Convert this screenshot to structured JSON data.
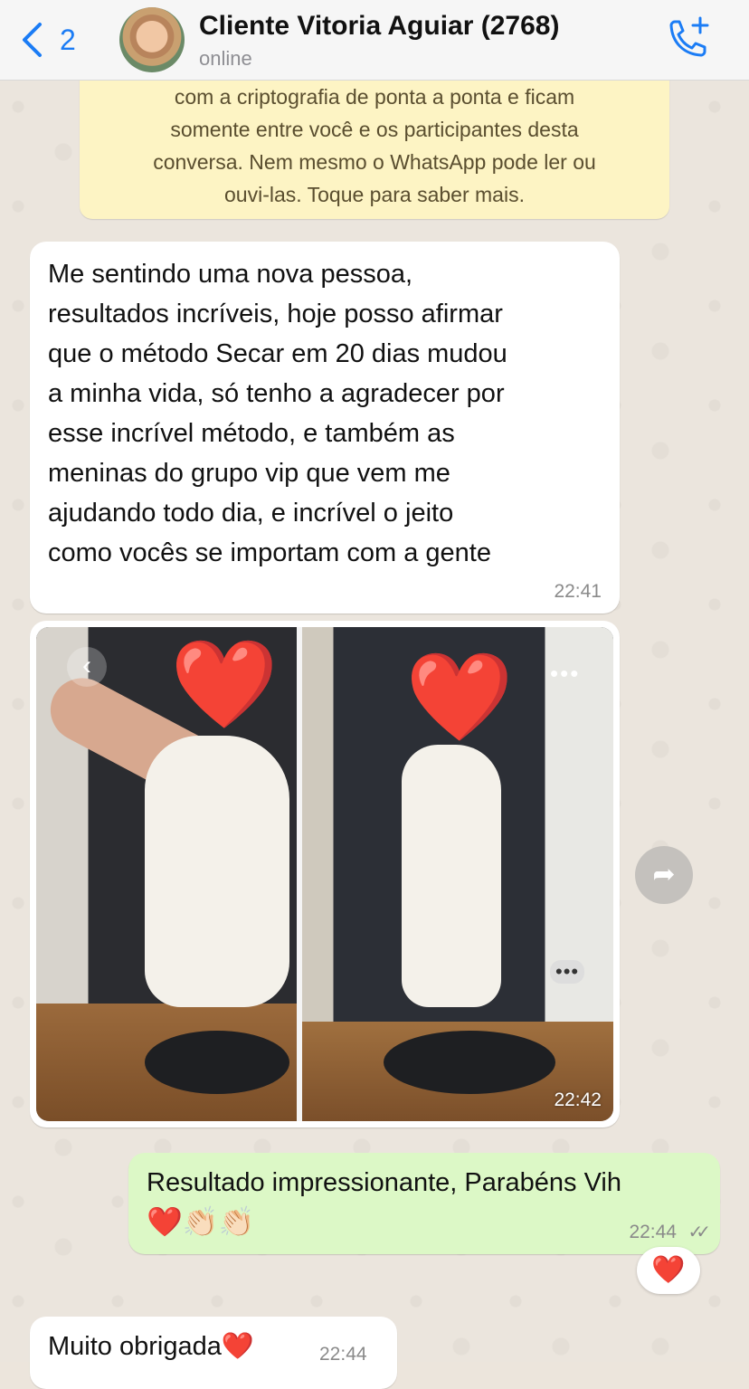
{
  "header": {
    "back_count": "2",
    "contact_name": "Cliente Vitoria Aguiar  (2768)",
    "contact_status": "online"
  },
  "notice": {
    "lines": [
      "com a criptografia de ponta a ponta e ficam",
      "somente entre você e os participantes desta",
      "conversa. Nem mesmo o WhatsApp pode ler ou",
      "ouvi-las. Toque para saber mais."
    ]
  },
  "messages": [
    {
      "direction": "incoming",
      "lines": [
        "Me sentindo uma nova pessoa,",
        "resultados incríveis, hoje posso afirmar",
        "que o método Secar em 20 dias mudou",
        "a minha vida, só tenho a agradecer por",
        "esse incrível método, e também as",
        "meninas do grupo vip que vem me",
        "ajudando todo dia, e incrível o jeito",
        "como vocês se importam com a gente"
      ],
      "time": "22:41"
    },
    {
      "direction": "incoming",
      "type": "image",
      "time": "22:42",
      "overlay_hearts": [
        "❤️",
        "❤️"
      ],
      "back_icon": "‹",
      "more_icon": "•••"
    },
    {
      "direction": "outgoing",
      "text": "Resultado impressionante, Parabéns Vih",
      "emojis": "❤️👏🏻👏🏻",
      "time": "22:44",
      "ticks": "✓✓",
      "reaction": "❤️"
    },
    {
      "direction": "incoming",
      "text": "Muito obrigada❤️",
      "time": "22:44"
    }
  ],
  "icons": {
    "back": "chevron-left-icon",
    "call": "phone-add-icon",
    "forward": "forward-arrow-icon"
  },
  "colors": {
    "accent": "#1b7cf5",
    "outgoing_bubble": "#dcf8c6",
    "notice_bg": "#fdf4c4",
    "chat_bg": "#ebe5dd"
  }
}
